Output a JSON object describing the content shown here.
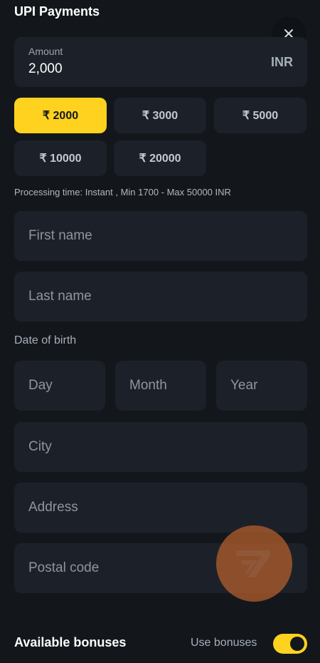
{
  "header": {
    "title": "UPI Payments",
    "close_icon": "close-icon"
  },
  "amount": {
    "label": "Amount",
    "value": "2,000",
    "currency": "INR"
  },
  "presets": [
    {
      "label": "₹ 2000",
      "selected": true
    },
    {
      "label": "₹ 3000",
      "selected": false
    },
    {
      "label": "₹ 5000",
      "selected": false
    },
    {
      "label": "₹ 10000",
      "selected": false
    },
    {
      "label": "₹ 20000",
      "selected": false
    }
  ],
  "processing_text": "Processing time: Instant , Min 1700 - Max 50000 INR",
  "fields": {
    "first_name": {
      "placeholder": "First name",
      "value": ""
    },
    "last_name": {
      "placeholder": "Last name",
      "value": ""
    },
    "dob_label": "Date of birth",
    "day": {
      "placeholder": "Day",
      "value": ""
    },
    "month": {
      "placeholder": "Month",
      "value": ""
    },
    "year": {
      "placeholder": "Year",
      "value": ""
    },
    "city": {
      "placeholder": "City",
      "value": ""
    },
    "address": {
      "placeholder": "Address",
      "value": ""
    },
    "postal_code": {
      "placeholder": "Postal code",
      "value": ""
    }
  },
  "bonuses": {
    "title": "Available bonuses",
    "use_label": "Use bonuses",
    "enabled": true
  },
  "colors": {
    "accent": "#ffd21f",
    "background": "#13171c",
    "field": "#1c2129"
  }
}
